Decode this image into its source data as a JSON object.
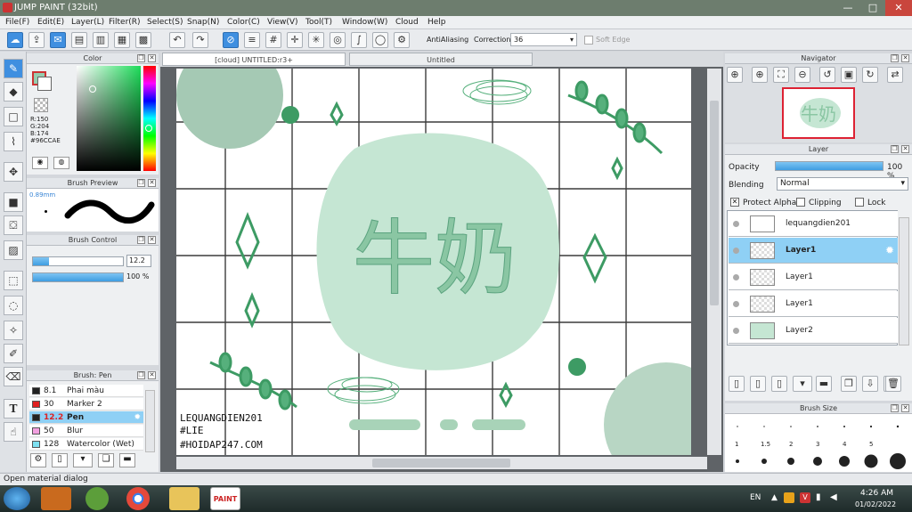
{
  "window": {
    "title": "JUMP PAINT (32bit)",
    "btn_min": "—",
    "btn_max": "□",
    "btn_close": "✕"
  },
  "menu": [
    "File(F)",
    "Edit(E)",
    "Layer(L)",
    "Filter(R)",
    "Select(S)",
    "Snap(N)",
    "Color(C)",
    "View(V)",
    "Tool(T)",
    "Window(W)",
    "Cloud",
    "Help"
  ],
  "toolbar": {
    "antialias_label": "AntiAliasing",
    "correction_label": "Correction",
    "correction_value": "36",
    "softedge_label": "Soft Edge"
  },
  "color_panel": {
    "title": "Color",
    "r": "R:150",
    "g": "G:204",
    "b": "B:174",
    "hex": "#96CCAE",
    "accent": "#96CCAE"
  },
  "brush_preview": {
    "title": "Brush Preview",
    "size": "0.89mm"
  },
  "brush_control": {
    "title": "Brush Control",
    "size_value": "12.2",
    "opacity_value": "100 %",
    "size_level": 0.18,
    "opacity_level": 1.0
  },
  "brush_list": {
    "title": "Brush: Pen",
    "items": [
      {
        "size": "8.1",
        "name": "Phai màu",
        "color": "#222222"
      },
      {
        "size": "30",
        "name": "Marker 2",
        "color": "#e02020"
      },
      {
        "size": "12.2",
        "name": "Pen",
        "color": "#222222"
      },
      {
        "size": "50",
        "name": "Blur",
        "color": "#f3a0e0"
      },
      {
        "size": "128",
        "name": "Watercolor (Wet)",
        "color": "#7ee0f0"
      }
    ]
  },
  "canvas": {
    "tab_active": "[cloud] UNTITLED:r3+",
    "tab_inactive": "Untitled",
    "art_title": "牛奶",
    "art_lines": [
      "LEQUANGDIEN201",
      "#LIE",
      "#HOIDAP247.COM"
    ]
  },
  "navigator": {
    "title": "Navigator",
    "thumb_text": "牛奶"
  },
  "layer_panel": {
    "title": "Layer",
    "opacity_label": "Opacity",
    "opacity_value": "100 %",
    "blending_label": "Blending",
    "blending_value": "Normal",
    "protect_alpha": "Protect Alpha",
    "clipping": "Clipping",
    "lock": "Lock",
    "layers": [
      {
        "name": "lequangdien201"
      },
      {
        "name": "Layer1"
      },
      {
        "name": "Layer1"
      },
      {
        "name": "Layer1"
      },
      {
        "name": "Layer2"
      }
    ]
  },
  "brush_size": {
    "title": "Brush Size",
    "labels": [
      "1",
      "1.5",
      "2",
      "3",
      "4",
      "5"
    ]
  },
  "status": {
    "text": "Open material dialog"
  },
  "taskbar": {
    "lang": "EN",
    "time": "4:26 AM",
    "date": "01/02/2022",
    "paint_label": "PAINT"
  }
}
